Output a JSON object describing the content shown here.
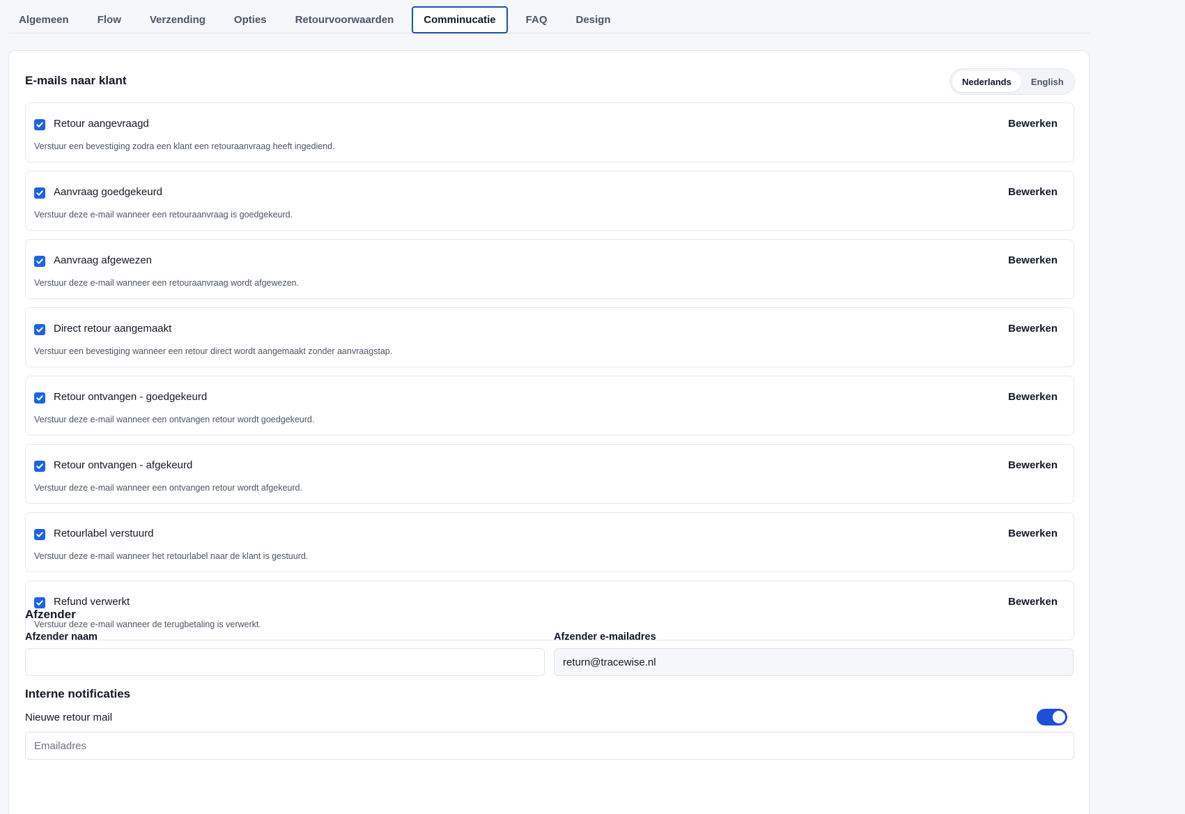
{
  "tabs": [
    {
      "label": "Algemeen",
      "active": false
    },
    {
      "label": "Flow",
      "active": false
    },
    {
      "label": "Verzending",
      "active": false
    },
    {
      "label": "Opties",
      "active": false
    },
    {
      "label": "Retourvoorwaarden",
      "active": false
    },
    {
      "label": "Comminucatie",
      "active": true
    },
    {
      "label": "FAQ",
      "active": false
    },
    {
      "label": "Design",
      "active": false
    }
  ],
  "emails_section": {
    "title": "E-mails naar klant",
    "languages": [
      {
        "label": "Nederlands",
        "active": true
      },
      {
        "label": "English",
        "active": false
      }
    ],
    "edit_label": "Bewerken",
    "items": [
      {
        "name": "Retour aangevraagd",
        "checked": true,
        "description": "Verstuur een bevestiging zodra een klant een retouraanvraag heeft ingediend."
      },
      {
        "name": "Aanvraag goedgekeurd",
        "checked": true,
        "description": "Verstuur deze e-mail wanneer een retouraanvraag is goedgekeurd."
      },
      {
        "name": "Aanvraag afgewezen",
        "checked": true,
        "description": "Verstuur deze e-mail wanneer een retouraanvraag wordt afgewezen."
      },
      {
        "name": "Direct retour aangemaakt",
        "checked": true,
        "description": "Verstuur een bevestiging wanneer een retour direct wordt aangemaakt zonder aanvraagstap."
      },
      {
        "name": "Retour ontvangen - goedgekeurd",
        "checked": true,
        "description": "Verstuur deze e-mail wanneer een ontvangen retour wordt goedgekeurd."
      },
      {
        "name": "Retour ontvangen - afgekeurd",
        "checked": true,
        "description": "Verstuur deze e-mail wanneer een ontvangen retour wordt afgekeurd."
      },
      {
        "name": "Retourlabel verstuurd",
        "checked": true,
        "description": "Verstuur deze e-mail wanneer het retourlabel naar de klant is gestuurd."
      },
      {
        "name": "Refund verwerkt",
        "checked": true,
        "description": "Verstuur deze e-mail wanneer de terugbetaling is verwerkt."
      }
    ]
  },
  "sender": {
    "title": "Afzender",
    "name_label": "Afzender naam",
    "name_value": "",
    "email_label": "Afzender e-mailadres",
    "email_value": "return@tracewise.nl"
  },
  "internal": {
    "title": "Interne notificaties",
    "new_return_label": "Nieuwe retour mail",
    "new_return_enabled": true,
    "email_placeholder": "Emailadres"
  },
  "colors": {
    "accent": "#1b64e4",
    "active_tab_border": "#1d4fa8",
    "toggle_on": "#1d4fd8"
  }
}
